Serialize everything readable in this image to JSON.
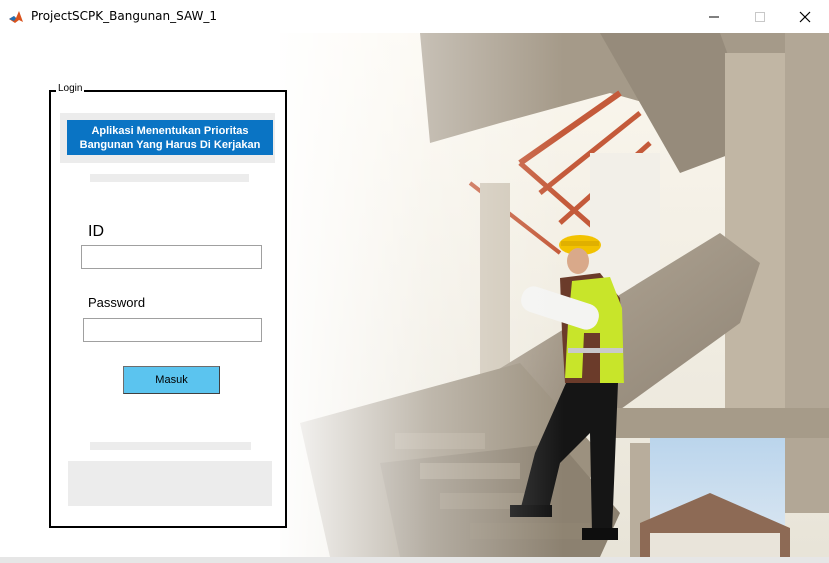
{
  "window": {
    "title": "ProjectSCPK_Bangunan_SAW_1",
    "icon": "matlab-icon",
    "controls": [
      "minimize-icon",
      "maximize-icon",
      "close-icon"
    ]
  },
  "login": {
    "legend": "Login",
    "header_title": "Aplikasi Menentukan Prioritas\nBangunan Yang Harus Di Kerjakan",
    "id_label": "ID",
    "id_value": "",
    "password_label": "Password",
    "password_value": "",
    "submit_label": "Masuk"
  },
  "colors": {
    "header_bg": "#0a74c4",
    "button_bg": "#5bc4ef",
    "panel_gray": "#ececec"
  },
  "background": {
    "image": "construction-worker-on-staircase-photo"
  }
}
